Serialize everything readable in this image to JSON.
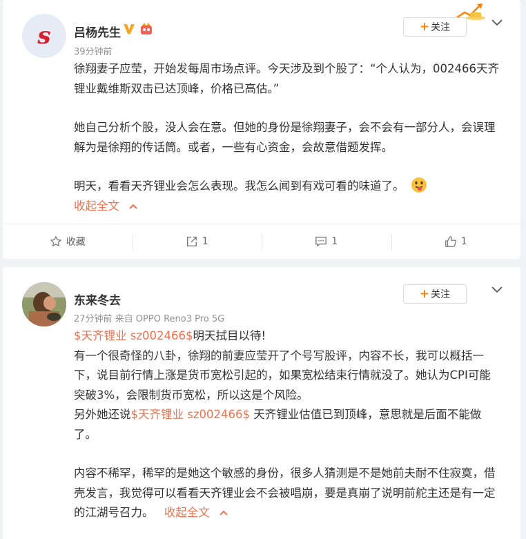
{
  "post1": {
    "author_name": "吕杨先生",
    "avatar_letter": "s",
    "time": "39分钟前",
    "follow_label": "关注",
    "paragraphs": [
      "徐翔妻子应莹，开始发每周市场点评。今天涉及到个股了：“个人认为，002466天齐锂业戴维斯双击已达顶峰，价格已高估。”",
      "她自己分析个股，没人会在意。但她的身份是徐翔妻子，会不会有一部分人，会误理解为是徐翔的传话筒。或者，一些有心资金，会故意借题发挥。",
      "明天，看看天齐锂业会怎么表现。我怎么闻到有戏可看的味道了。"
    ],
    "collapse_label": "收起全文",
    "actions": {
      "favorite": "收藏",
      "repost": "1",
      "comment": "1",
      "like": "1"
    }
  },
  "post2": {
    "author_name": "东来冬去",
    "meta": "27分钟前 来自 OPPO Reno3 Pro 5G",
    "follow_label": "关注",
    "line1_tag": "$天齐锂业 sz002466$",
    "line1_rest": "明天拭目以待!",
    "para1": "有一个很奇怪的八卦，徐翔的前妻应莹开了个号写股评，内容不长，我可以概括一下，说目前行情上涨是货币宽松引起的，如果宽松结束行情就没了。她认为CPI可能突破3%，会限制货币宽松，所以这是个风险。",
    "para2_pre": "另外她还说",
    "para2_tag": "$天齐锂业 sz002466$",
    "para2_rest": " 天齐锂业估值已到顶峰，意思就是后面不能做了。",
    "para3": "内容不稀罕，稀罕的是她这个敏感的身份，很多人猜测是不是她前夫耐不住寂寞，借壳发言，我觉得可以看看天齐锂业会不会被唱崩，要是真崩了说明前舵主还是有一定的江湖号召力。",
    "collapse_label": "收起全文"
  },
  "colors": {
    "accent_orange": "#eb7350",
    "follow_plus": "#ff8200",
    "text": "#333333",
    "meta": "#939393"
  }
}
